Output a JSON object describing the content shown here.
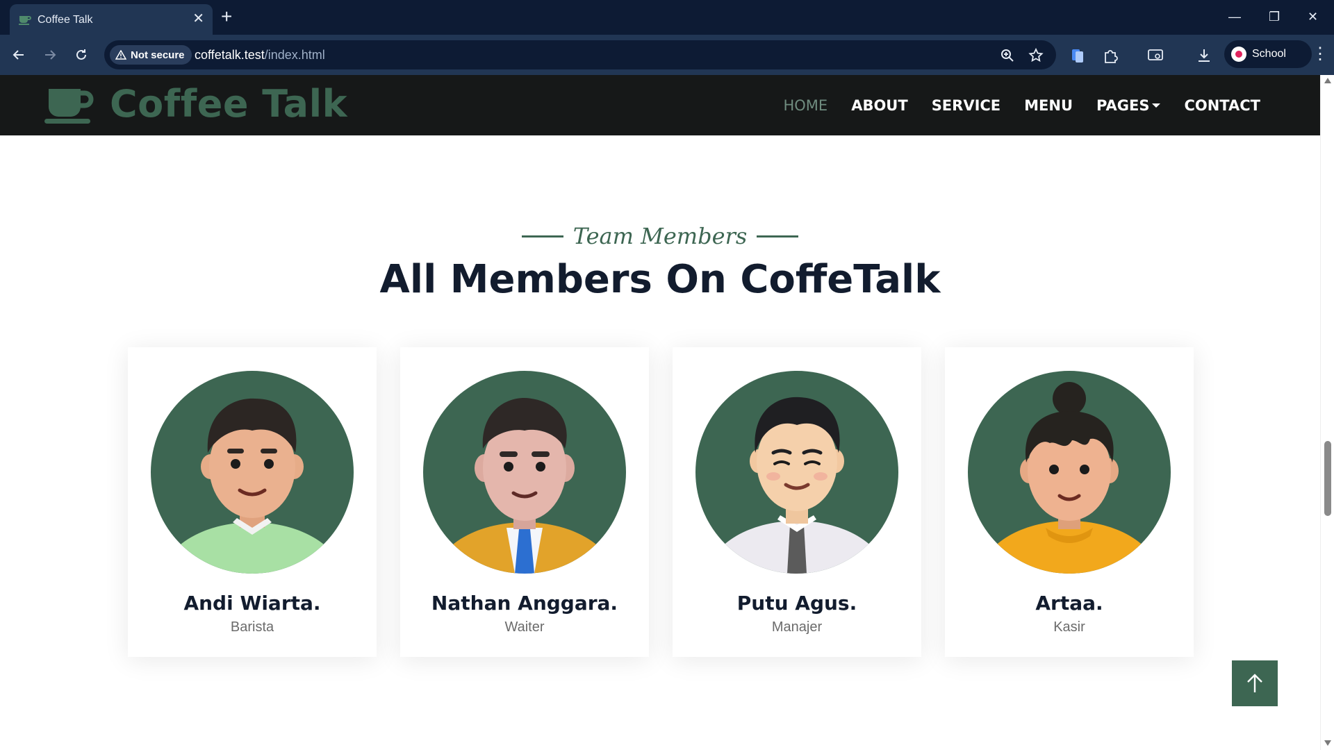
{
  "browser": {
    "tab_title": "Coffee Talk",
    "security_label": "Not secure",
    "url_host": "coffetalk.test",
    "url_path": "/index.html",
    "profile_label": "School"
  },
  "nav": {
    "brand": "Coffee Talk",
    "links": [
      {
        "label": "HOME",
        "active": true
      },
      {
        "label": "ABOUT"
      },
      {
        "label": "SERVICE"
      },
      {
        "label": "MENU"
      },
      {
        "label": "PAGES",
        "dropdown": true
      },
      {
        "label": "CONTACT"
      }
    ]
  },
  "section": {
    "subtitle": "Team Members",
    "title": "All Members On CoffeTalk"
  },
  "team": [
    {
      "name": "Andi Wiarta.",
      "role": "Barista"
    },
    {
      "name": "Nathan Anggara.",
      "role": "Waiter"
    },
    {
      "name": "Putu Agus.",
      "role": "Manajer"
    },
    {
      "name": "Artaa.",
      "role": "Kasir"
    }
  ],
  "colors": {
    "brand_green": "#3d6652",
    "nav_background": "#161818",
    "heading": "#121c2e",
    "browser_frame": "#0d1b34"
  },
  "icons": {
    "logo": "coffee-cup-icon",
    "back_to_top": "arrow-up-icon"
  }
}
